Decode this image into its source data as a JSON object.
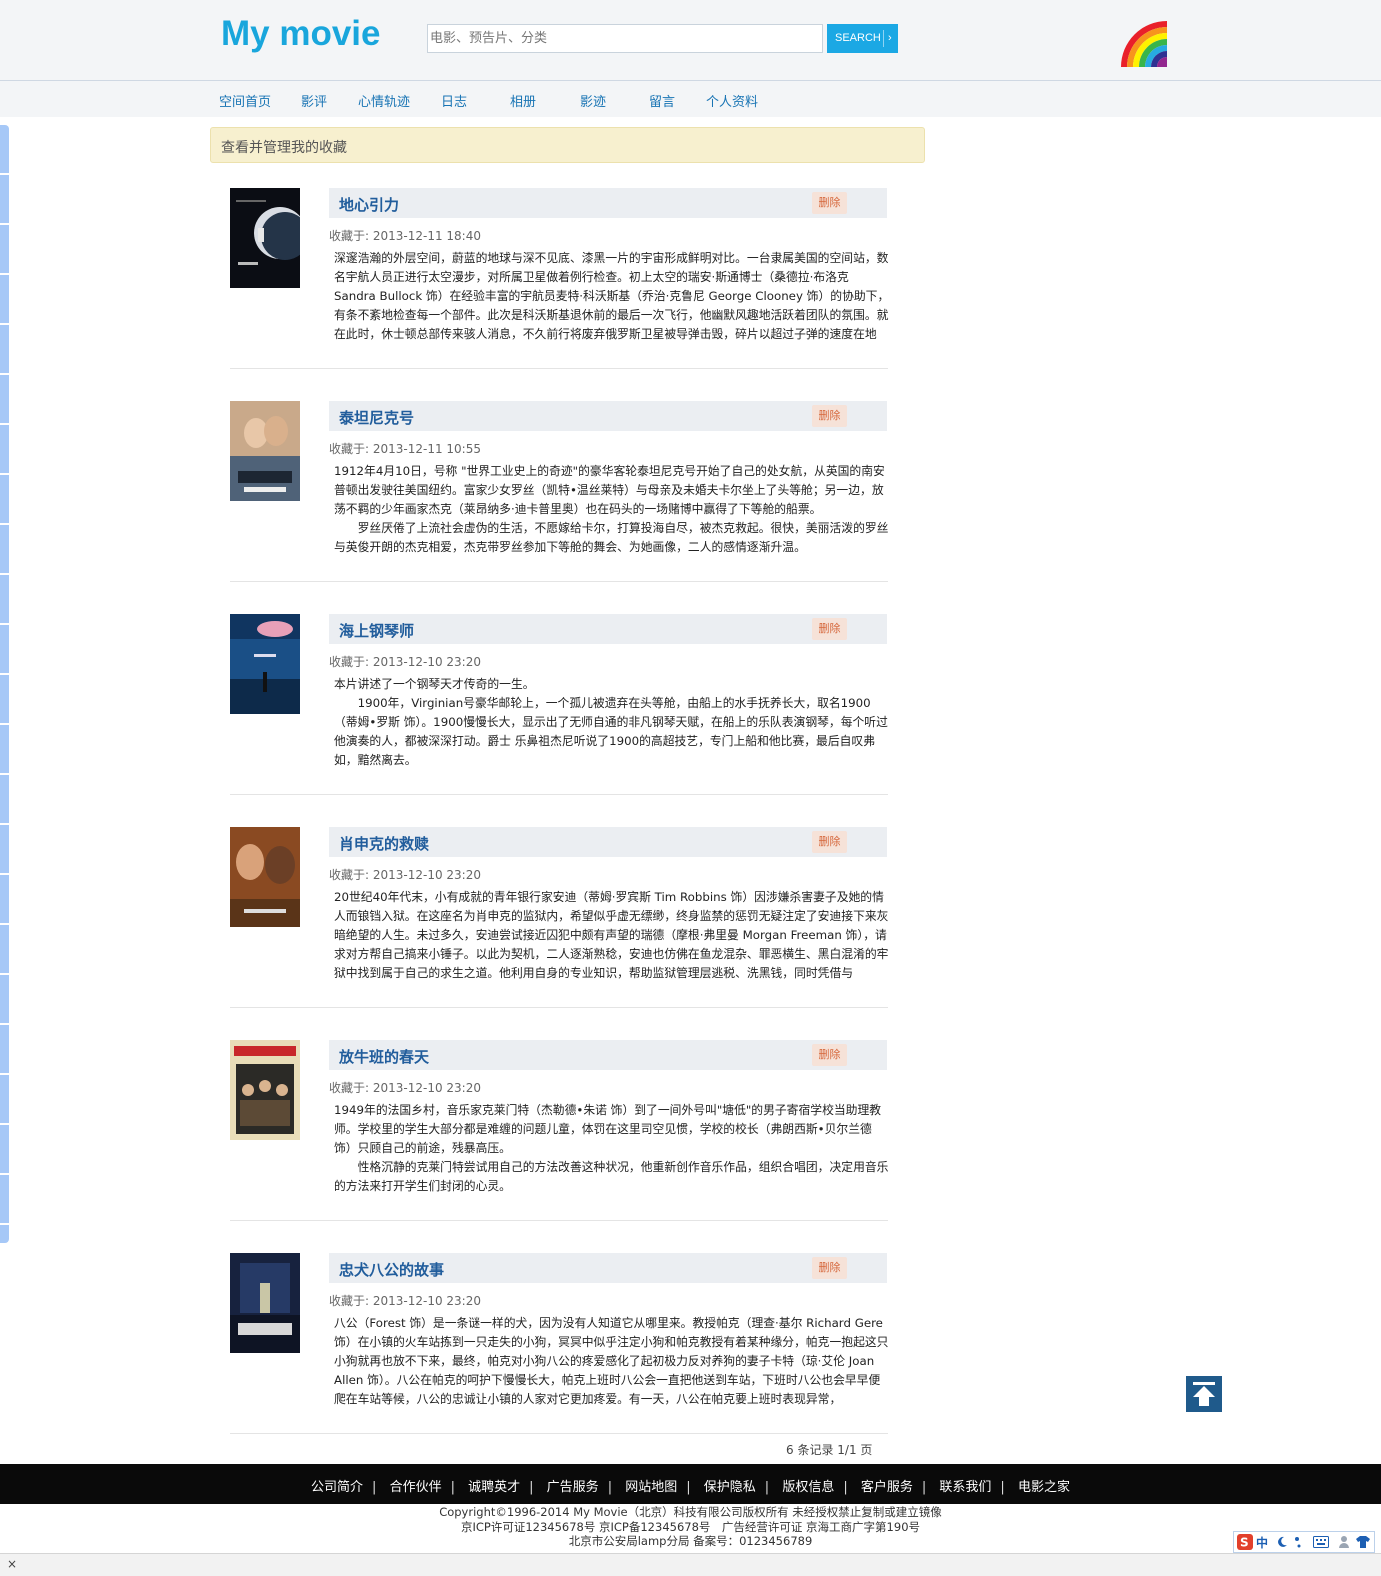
{
  "header": {
    "logo": "My movie",
    "search_placeholder": "电影、预告片、分类",
    "search_button": "SEARCH",
    "search_chevron": "›"
  },
  "nav": [
    "空间首页",
    "影评",
    "心情轨迹",
    "日志",
    "相册",
    "影迹",
    "留言",
    "个人资料"
  ],
  "notice": "查看并管理我的收藏",
  "delete_label": "删除",
  "entries": [
    {
      "title": "地心引力",
      "date": "收藏于: 2013-12-11 18:40",
      "desc": "深邃浩瀚的外层空间，蔚蓝的地球与深不见底、漆黑一片的宇宙形成鲜明对比。一台隶属美国的空间站，数名宇航人员正进行太空漫步，对所属卫星做着例行检查。初上太空的瑞安·斯通博士（桑德拉·布洛克 Sandra Bullock 饰）在经验丰富的宇航员麦特·科沃斯基（乔治·克鲁尼 George Clooney 饰）的协助下，有条不紊地检查每一个部件。此次是科沃斯基退休前的最后一次飞行，他幽默风趣地活跃着团队的氛围。就在此时，休士顿总部传来骇人消息，不久前行将废弃俄罗斯卫星被导弹击毁，碎片以超过子弹的速度在地"
    },
    {
      "title": "泰坦尼克号",
      "date": "收藏于: 2013-12-11 10:55",
      "desc": "1912年4月10日，号称 \"世界工业史上的奇迹\"的豪华客轮泰坦尼克号开始了自己的处女航，从英国的南安普顿出发驶往美国纽约。富家少女罗丝（凯特•温丝莱特）与母亲及未婚夫卡尔坐上了头等舱；另一边，放荡不羁的少年画家杰克（莱昂纳多·迪卡普里奥）也在码头的一场赌博中赢得了下等舱的船票。\n　　罗丝厌倦了上流社会虚伪的生活，不愿嫁给卡尔，打算投海自尽，被杰克救起。很快，美丽活泼的罗丝与英俊开朗的杰克相爱，杰克带罗丝参加下等舱的舞会、为她画像，二人的感情逐渐升温。"
    },
    {
      "title": "海上钢琴师",
      "date": "收藏于: 2013-12-10 23:20",
      "desc": "本片讲述了一个钢琴天才传奇的一生。\n　　1900年，Virginian号豪华邮轮上，一个孤儿被遗弃在头等舱，由船上的水手抚养长大，取名1900（蒂姆•罗斯 饰）。1900慢慢长大，显示出了无师自通的非凡钢琴天赋，在船上的乐队表演钢琴，每个听过他演奏的人，都被深深打动。爵士 乐鼻祖杰尼听说了1900的高超技艺，专门上船和他比赛，最后自叹弗如，黯然离去。"
    },
    {
      "title": "肖申克的救赎",
      "date": "收藏于: 2013-12-10 23:20",
      "desc": "20世纪40年代末，小有成就的青年银行家安迪（蒂姆·罗宾斯 Tim Robbins 饰）因涉嫌杀害妻子及她的情人而锒铛入狱。在这座名为肖申克的监狱内，希望似乎虚无缥缈，终身监禁的惩罚无疑注定了安迪接下来灰暗绝望的人生。未过多久，安迪尝试接近囚犯中颇有声望的瑞德（摩根·弗里曼 Morgan Freeman 饰），请求对方帮自己搞来小锤子。以此为契机，二人逐渐熟稔，安迪也仿佛在鱼龙混杂、罪恶横生、黑白混淆的牢狱中找到属于自己的求生之道。他利用自身的专业知识，帮助监狱管理层逃税、洗黑钱，同时凭借与"
    },
    {
      "title": "放牛班的春天",
      "date": "收藏于: 2013-12-10 23:20",
      "desc": "1949年的法国乡村，音乐家克莱门特（杰勒德•朱诺 饰）到了一间外号叫\"塘低\"的男子寄宿学校当助理教师。学校里的学生大部分都是难缠的问题儿童，体罚在这里司空见惯，学校的校长（弗朗西斯•贝尔兰德 饰）只顾自己的前途，残暴高压。\n　　性格沉静的克莱门特尝试用自己的方法改善这种状况，他重新创作音乐作品，组织合唱团，决定用音乐的方法来打开学生们封闭的心灵。"
    },
    {
      "title": "忠犬八公的故事",
      "date": "收藏于: 2013-12-10 23:20",
      "desc": "八公（Forest 饰）是一条谜一样的犬，因为没有人知道它从哪里来。教授帕克（理查·基尔 Richard Gere 饰）在小镇的火车站拣到一只走失的小狗，冥冥中似乎注定小狗和帕克教授有着某种缘分，帕克一抱起这只小狗就再也放不下来，最终，帕克对小狗八公的疼爱感化了起初极力反对养狗的妻子卡特（琼·艾伦 Joan Allen 饰）。八公在帕克的呵护下慢慢长大，帕克上班时八公会一直把他送到车站，下班时八公也会早早便爬在车站等候，八公的忠诚让小镇的人家对它更加疼爱。有一天，八公在帕克要上班时表现异常，"
    }
  ],
  "pager": "6 条记录 1/1 页",
  "footer": {
    "links": [
      "公司简介",
      "合作伙伴",
      "诚聘英才",
      "广告服务",
      "网站地图",
      "保护隐私",
      "版权信息",
      "客户服务",
      "联系我们",
      "电影之家"
    ],
    "separator": "|",
    "copyright_lines": [
      "Copyright©1996-2014 My Movie（北京）科技有限公司版权所有 未经授权禁止复制或建立镜像",
      "京ICP许可证12345678号 京ICP备12345678号　广告经营许可证 京海工商广字第190号",
      "北京市公安局lamp分局 备案号：0123456789"
    ]
  },
  "ime": {
    "zh": "中"
  },
  "status_close": "×",
  "icons": [
    "rainbow-logo-icon",
    "search-chevron-icon",
    "back-to-top-icon",
    "ime-logo-icon"
  ],
  "colors": {
    "accent": "#19a6dc",
    "nav_link": "#1874b4",
    "title": "#215d9c",
    "delete": "#d5663a",
    "notice_bg": "#f7f0cf",
    "footer_bg": "#0a0a0a"
  }
}
